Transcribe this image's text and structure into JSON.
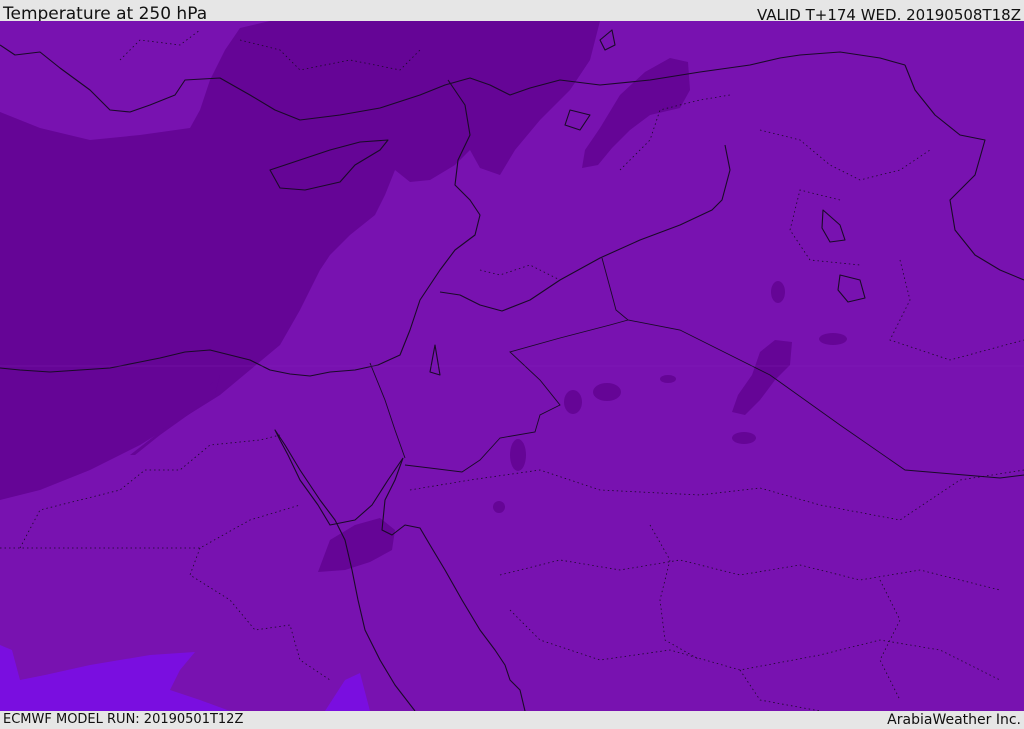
{
  "header": {
    "title": "Temperature at 250 hPa",
    "valid": "VALID T+174 WED. 20190508T18Z"
  },
  "footer": {
    "model_run": "ECMWF MODEL RUN: 20190501T12Z",
    "credit": "ArabiaWeather Inc."
  },
  "map": {
    "field": "temperature-250hPa",
    "colors": {
      "dark": "#650596",
      "mid": "#7812b0",
      "light": "#7a0ee0",
      "coast": "#1a0a28"
    }
  }
}
